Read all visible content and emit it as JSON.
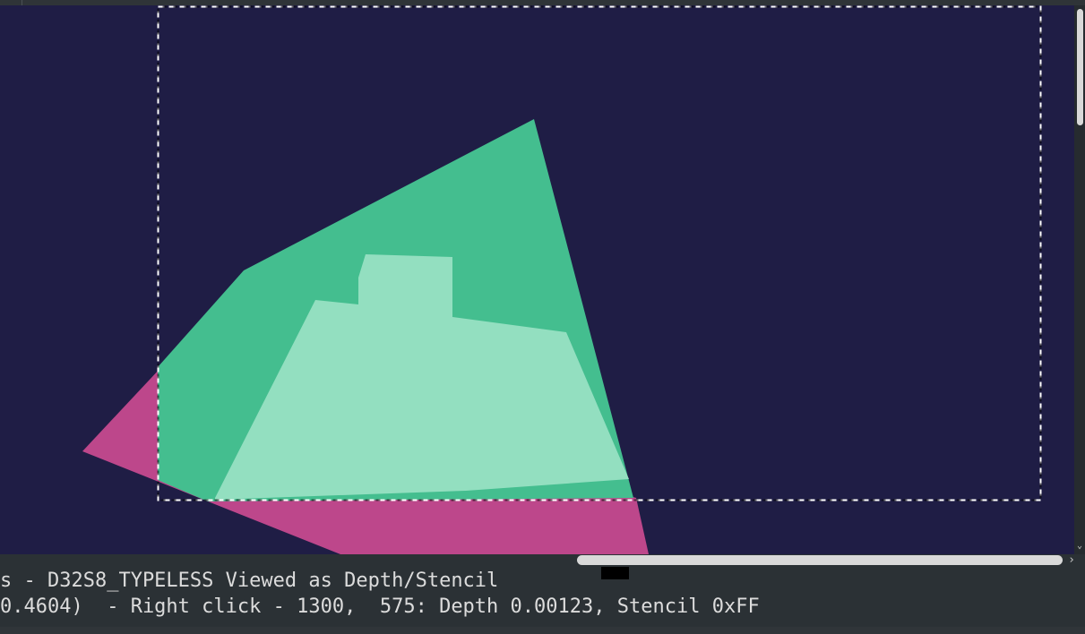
{
  "viewer": {
    "canvas_background": "#1f1d45",
    "selection_border_color": "#ffffff",
    "shapes": [
      {
        "name": "magenta-triangle",
        "color": "#bd478b"
      },
      {
        "name": "green-quad",
        "color": "#44be8f"
      },
      {
        "name": "light-green-shape",
        "color": "#93dfc0"
      }
    ]
  },
  "status": {
    "line1": "s - D32S8_TYPELESS Viewed as Depth/Stencil",
    "line2": "0.4604)  - Right click - 1300,  575: Depth 0.00123, Stencil 0xFF"
  },
  "scrollbars": {
    "vertical_arrow": "⌄",
    "horizontal_arrow": "›"
  }
}
